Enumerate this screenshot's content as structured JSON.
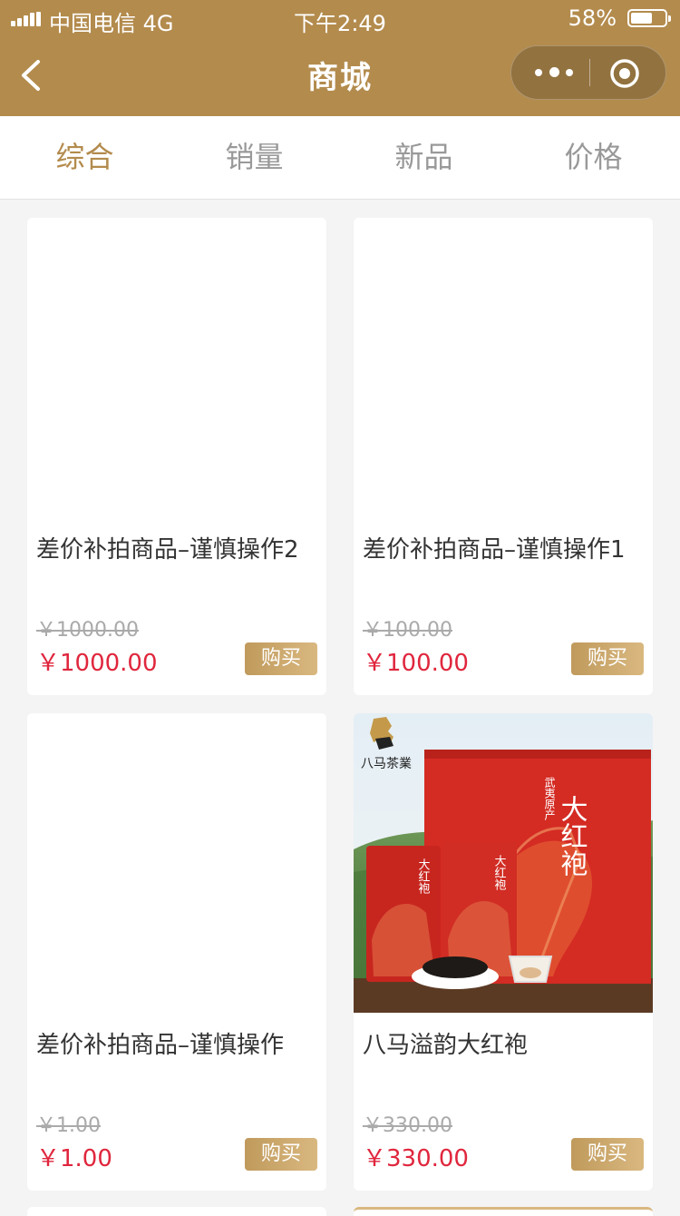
{
  "status_bar": {
    "carrier": "中国电信  4G",
    "time": "下午2:49",
    "battery": "58%"
  },
  "nav": {
    "title": "商城"
  },
  "tabs": [
    {
      "label": "综合",
      "active": true
    },
    {
      "label": "销量",
      "active": false
    },
    {
      "label": "新品",
      "active": false
    },
    {
      "label": "价格",
      "active": false
    }
  ],
  "products": [
    {
      "name": "差价补拍商品–谨慎操作2",
      "original_price": "￥1000.00",
      "price": "￥1000.00",
      "buy_label": "购买"
    },
    {
      "name": "差价补拍商品–谨慎操作1",
      "original_price": "￥100.00",
      "price": "￥100.00",
      "buy_label": "购买"
    },
    {
      "name": "差价补拍商品–谨慎操作",
      "original_price": "￥1.00",
      "price": "￥1.00",
      "buy_label": "购买"
    },
    {
      "name": "八马溢韵大红袍",
      "original_price": "￥330.00",
      "price": "￥330.00",
      "buy_label": "购买"
    }
  ],
  "product_image": {
    "brand": "八马茶業",
    "box_title": "大红袍",
    "box_subtitle": "武夷原产",
    "tin_title": "大红袍"
  },
  "colors": {
    "accent": "#b38b4d",
    "price": "#e0263d",
    "tea_red": "#d42b23"
  }
}
